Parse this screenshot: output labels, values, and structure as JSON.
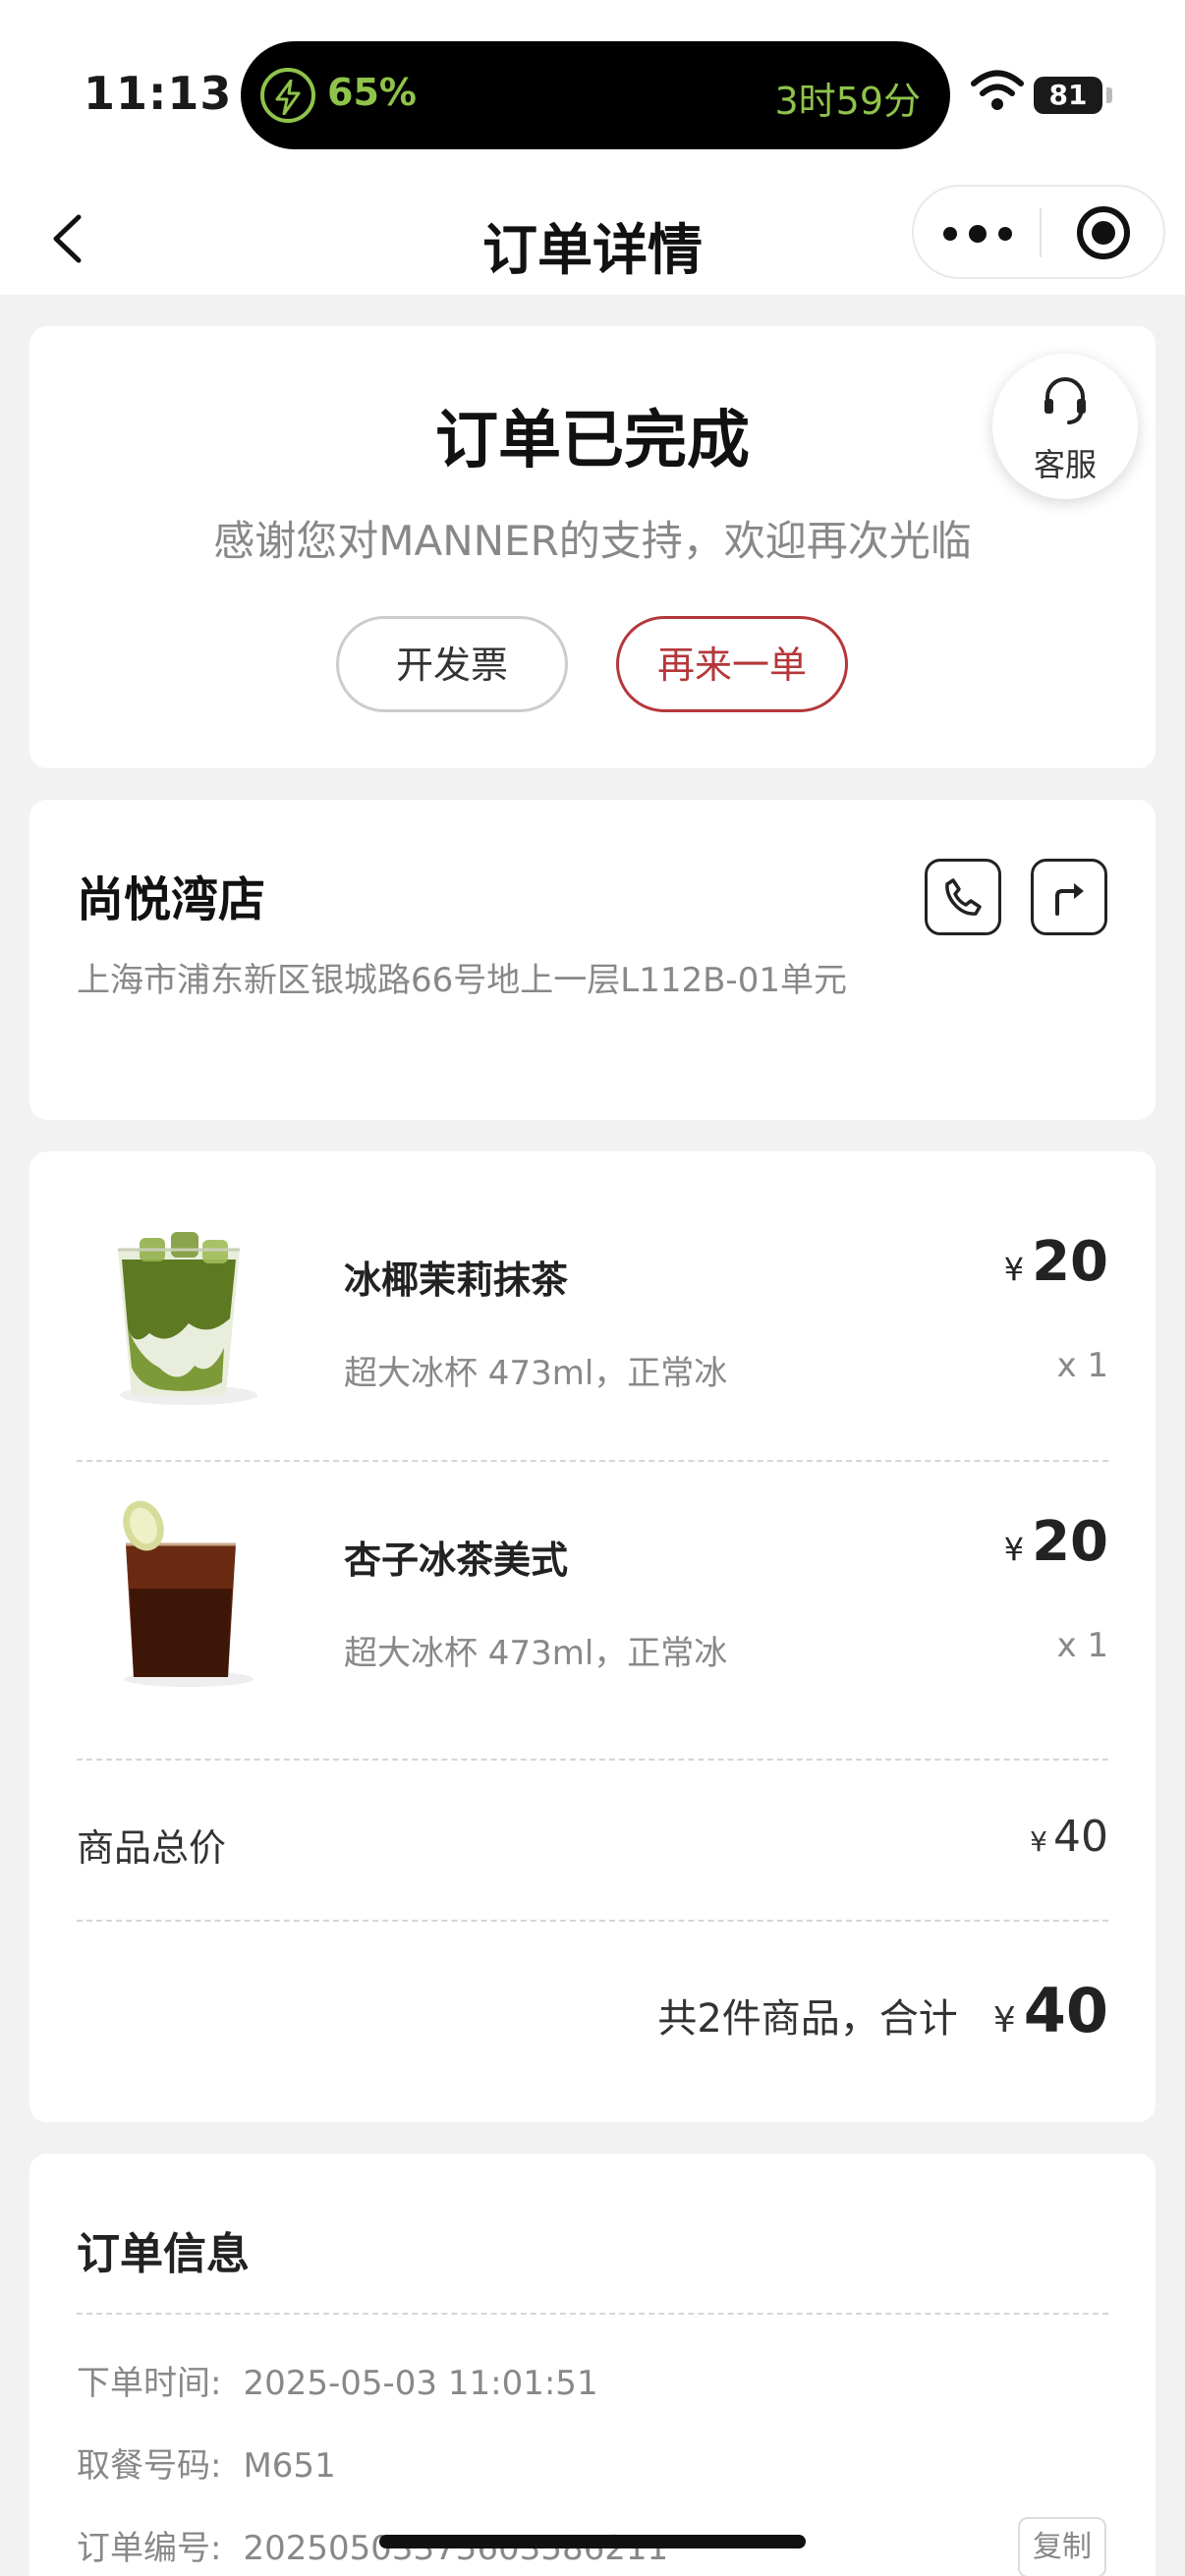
{
  "status_bar": {
    "time": "11:13",
    "island_charge": "65%",
    "island_remaining": "3时59分",
    "battery": "81",
    "accent_color": "#8fc34a"
  },
  "nav": {
    "title": "订单详情"
  },
  "order_status": {
    "title": "订单已完成",
    "subtitle": "感谢您对MANNER的支持，欢迎再次光临",
    "invoice_button": "开发票",
    "reorder_button": "再来一单",
    "service_label": "客服",
    "accent_color": "#b5373a"
  },
  "store": {
    "name": "尚悦湾店",
    "address": "上海市浦东新区银城路66号地上一层L112B-01单元",
    "icons": [
      "phone-icon",
      "directions-icon"
    ]
  },
  "items": [
    {
      "name": "冰椰茉莉抹茶",
      "spec": "超大冰杯 473ml，正常冰",
      "currency": "¥",
      "price": "20",
      "qty": "x 1",
      "icon": "matcha-drink-image"
    },
    {
      "name": "杏子冰茶美式",
      "spec": "超大冰杯 473ml，正常冰",
      "currency": "¥",
      "price": "20",
      "qty": "x 1",
      "icon": "iced-americano-image"
    }
  ],
  "summary": {
    "subtotal_label": "商品总价",
    "subtotal_currency": "¥",
    "subtotal_value": "40",
    "total_prefix": "共2件商品，合计",
    "total_currency": "¥",
    "total_value": "40"
  },
  "order_info": {
    "title": "订单信息",
    "time_label": "下单时间:",
    "time_value": "2025-05-03 11:01:51",
    "pickup_label": "取餐号码:",
    "pickup_value": "M651",
    "number_label": "订单编号:",
    "number_value": "20250503375603586211",
    "copy_button": "复制"
  }
}
